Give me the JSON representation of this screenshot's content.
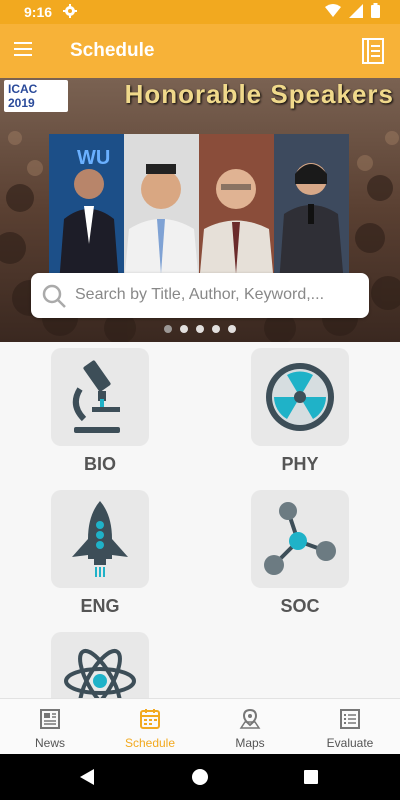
{
  "status_bar": {
    "time": "9:16"
  },
  "app_bar": {
    "title": "Schedule"
  },
  "banner": {
    "heading": "Honorable Speakers",
    "logo_text": "ICAC 2019",
    "photo_sign_text": "WU",
    "search_placeholder": "Search by Title, Author, Keyword,...",
    "carousel_dots": 5,
    "active_dot": 0
  },
  "categories": [
    {
      "label": "BIO",
      "icon": "microscope-icon"
    },
    {
      "label": "PHY",
      "icon": "radiation-icon"
    },
    {
      "label": "ENG",
      "icon": "rocket-icon"
    },
    {
      "label": "SOC",
      "icon": "network-icon"
    },
    {
      "label": "",
      "icon": "atom-icon"
    }
  ],
  "bottom_nav": [
    {
      "label": "News",
      "icon": "newspaper-icon",
      "active": false
    },
    {
      "label": "Schedule",
      "icon": "calendar-icon",
      "active": true
    },
    {
      "label": "Maps",
      "icon": "map-pin-icon",
      "active": false
    },
    {
      "label": "Evaluate",
      "icon": "checklist-icon",
      "active": false
    }
  ],
  "colors": {
    "primary": "#f7b238",
    "status": "#f2a91f",
    "icon_dark": "#3d4e58",
    "icon_accent": "#1fb2c8"
  }
}
